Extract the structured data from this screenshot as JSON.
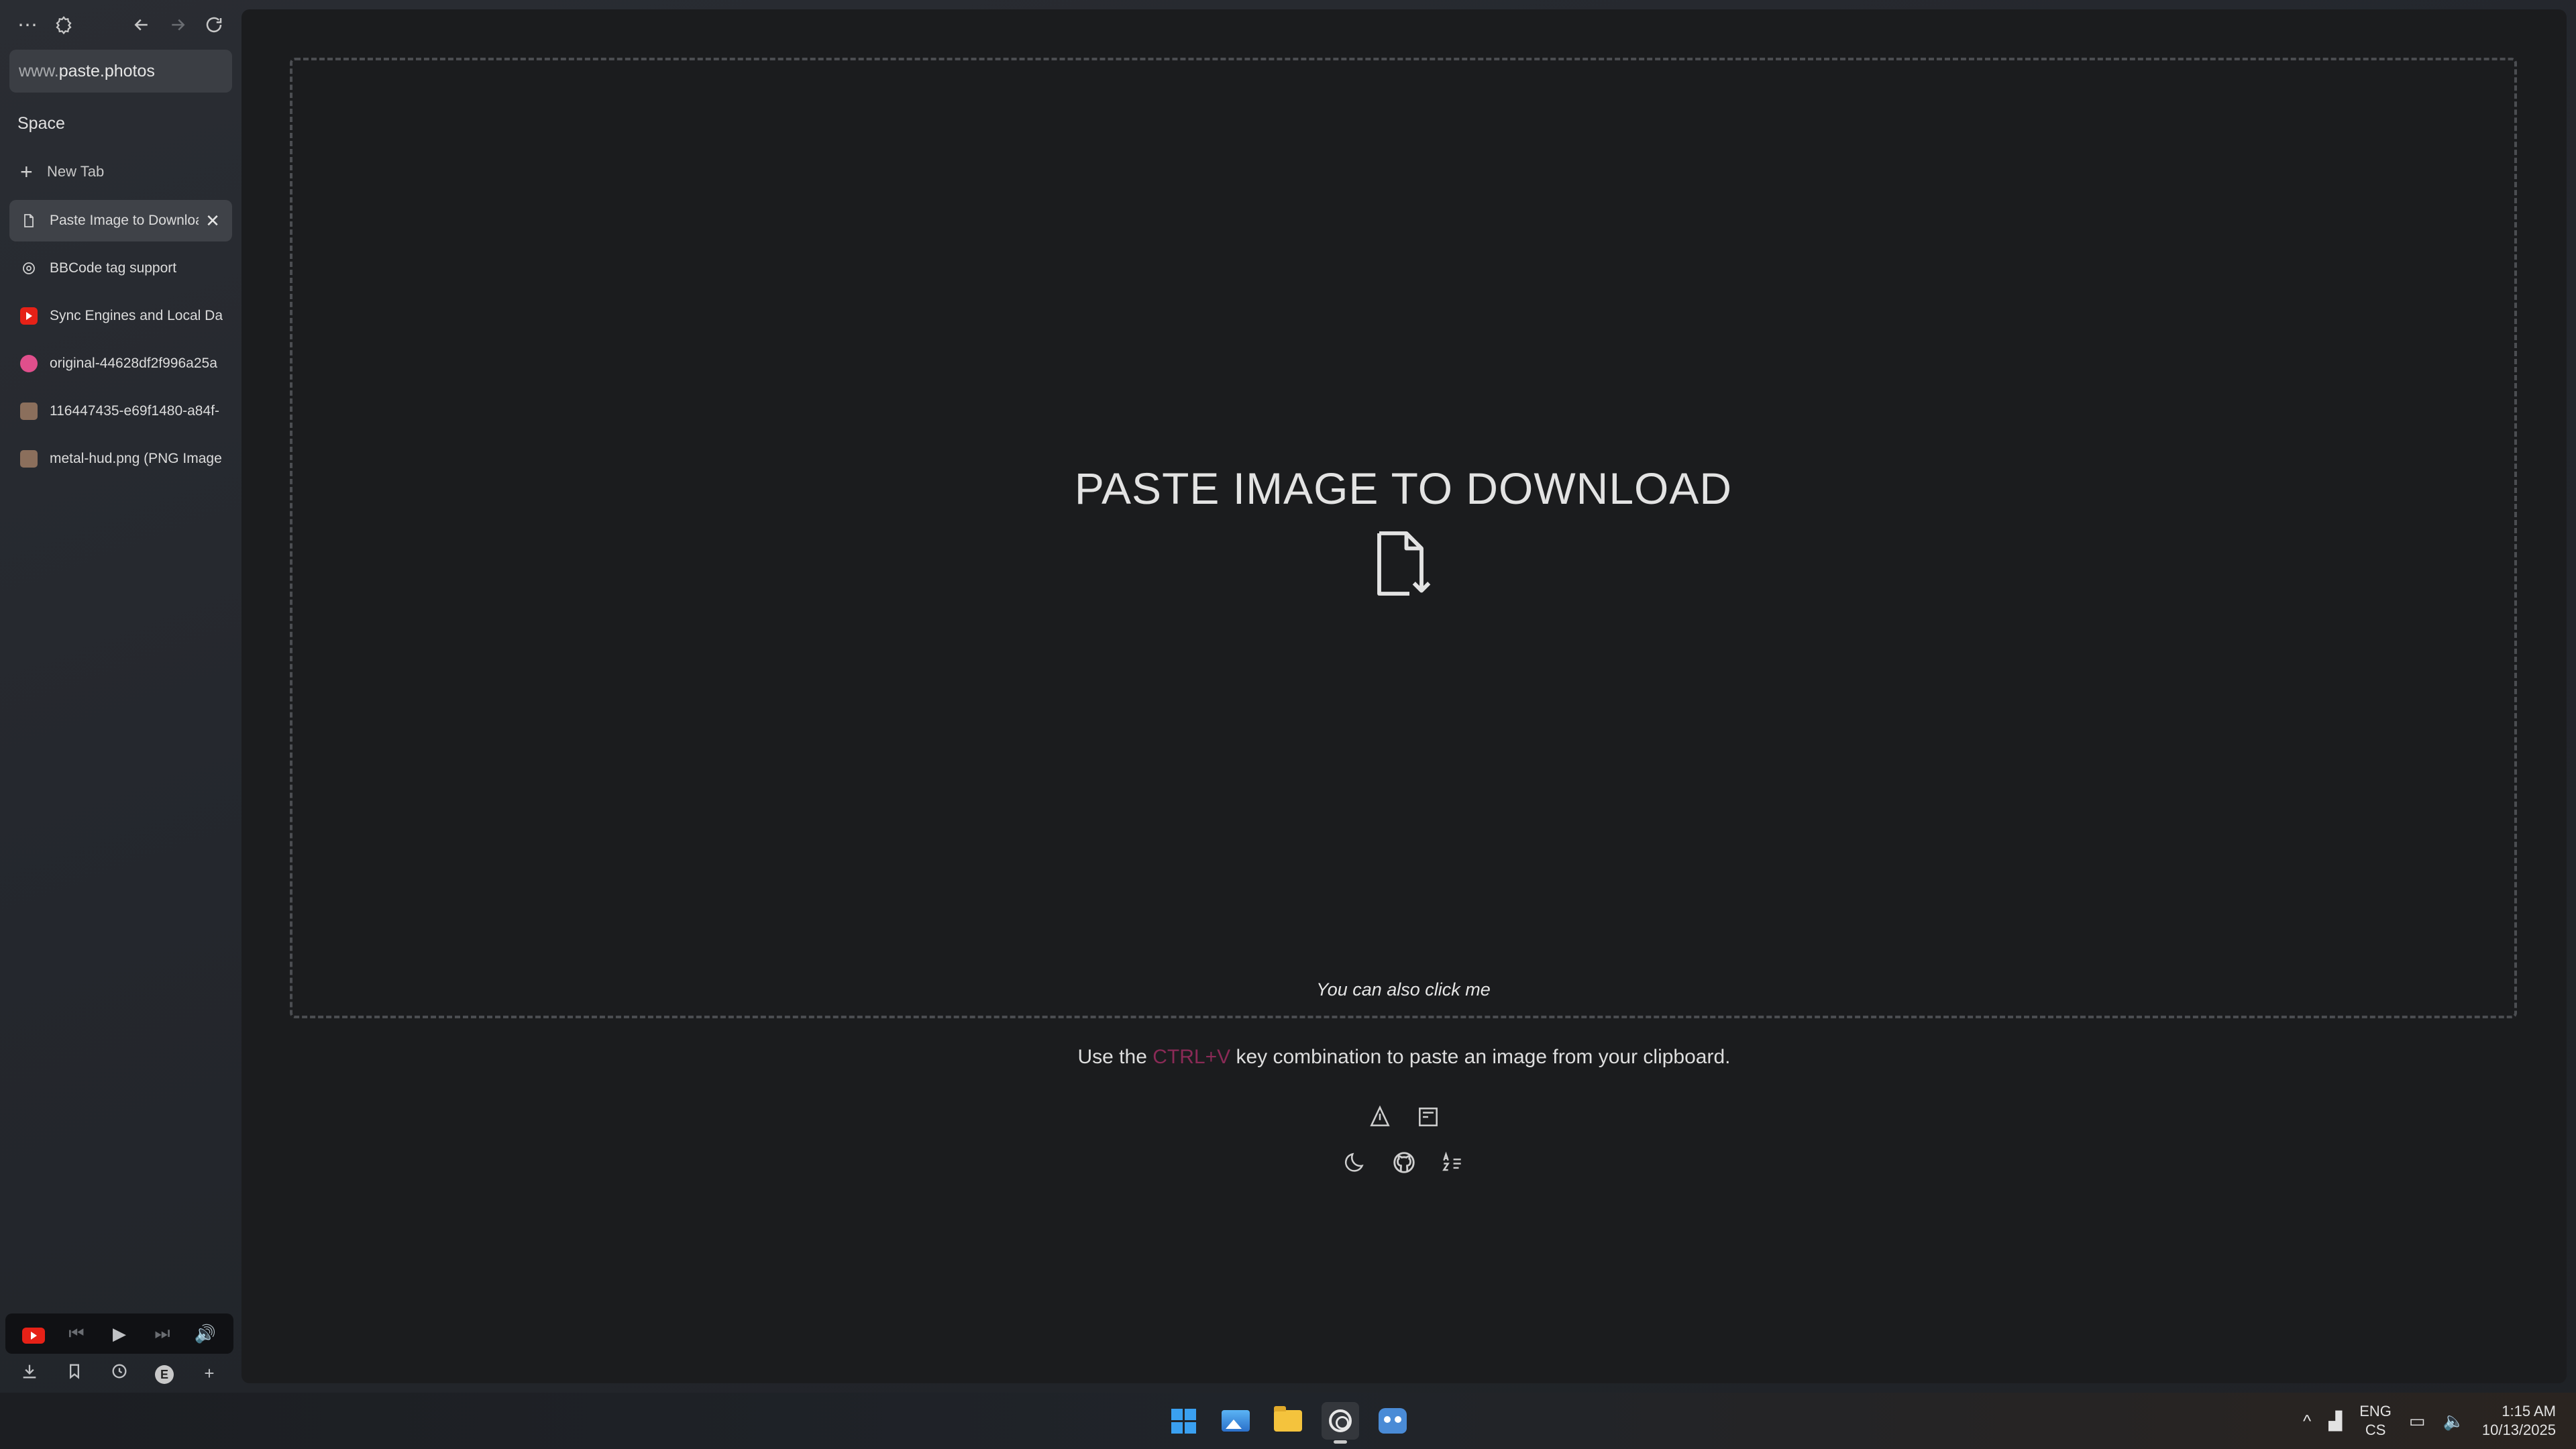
{
  "browser": {
    "url_prefix": "www.",
    "url_domain": "paste.photos",
    "space_label": "Space",
    "new_tab_label": "New Tab",
    "tabs": [
      {
        "title": "Paste Image to Download",
        "favicon": "document-icon",
        "active": true
      },
      {
        "title": "BBCode tag support",
        "favicon": "gear-icon",
        "active": false
      },
      {
        "title": "Sync Engines and Local Data",
        "favicon": "youtube-icon",
        "active": false
      },
      {
        "title": "original-44628df2f996a25a",
        "favicon": "dribbble-icon",
        "active": false
      },
      {
        "title": "116447435-e69f1480-a84f-",
        "favicon": "image-icon",
        "active": false
      },
      {
        "title": "metal-hud.png (PNG Image",
        "favicon": "image-icon",
        "active": false
      }
    ]
  },
  "page": {
    "heading": "PASTE IMAGE TO DOWNLOAD",
    "click_hint": "You can also click me",
    "usage_before": "Use the ",
    "usage_key": "CTRL+V",
    "usage_after": " key combination to paste an image from your clipboard.",
    "accent_key_color": "#8a2a56"
  },
  "taskbar": {
    "lang_top": "ENG",
    "lang_bottom": "CS",
    "time": "1:15 AM",
    "date": "10/13/2025",
    "apps": [
      "start-icon",
      "photos-icon",
      "file-explorer-icon",
      "browser-icon",
      "godot-icon"
    ]
  }
}
